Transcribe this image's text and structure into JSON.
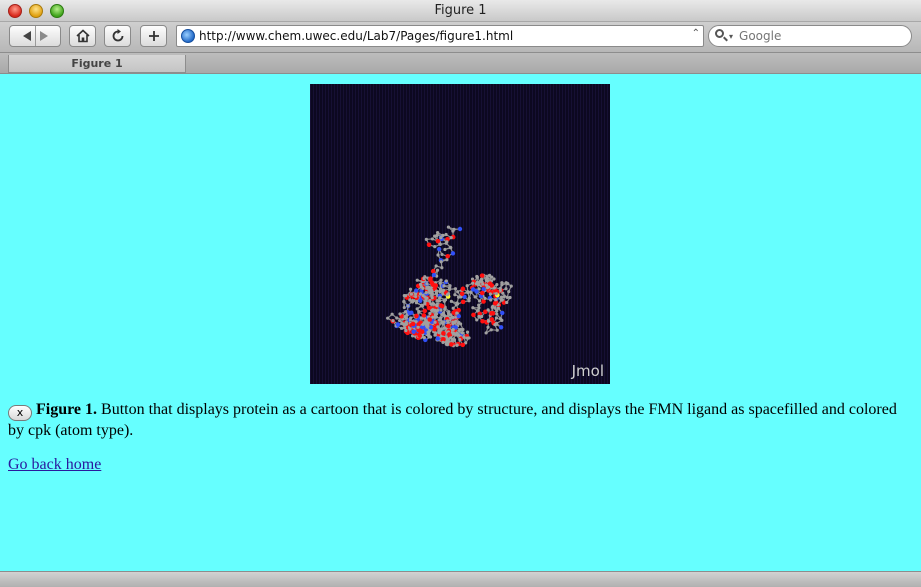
{
  "window": {
    "title": "Figure 1"
  },
  "toolbar": {
    "url": "http://www.chem.uwec.edu/Lab7/Pages/figure1.html",
    "search_placeholder": "Google"
  },
  "tabs": [
    {
      "label": "Figure 1"
    }
  ],
  "content": {
    "background": "#66ffff",
    "viewer": {
      "label": "Jmol",
      "background": "#0c0820"
    },
    "caption": {
      "button_label": "x",
      "figure_label": "Figure 1.",
      "text": "Button that displays protein as a cartoon that is colored by structure, and displays the FMN ligand as spacefilled and colored by cpk (atom type)."
    },
    "home_link": "Go back home"
  },
  "colors": {
    "atom_carbon": "#a0a0a0",
    "atom_oxygen": "#ff1010",
    "atom_nitrogen": "#3050f8",
    "atom_sulfur": "#ffff30"
  }
}
